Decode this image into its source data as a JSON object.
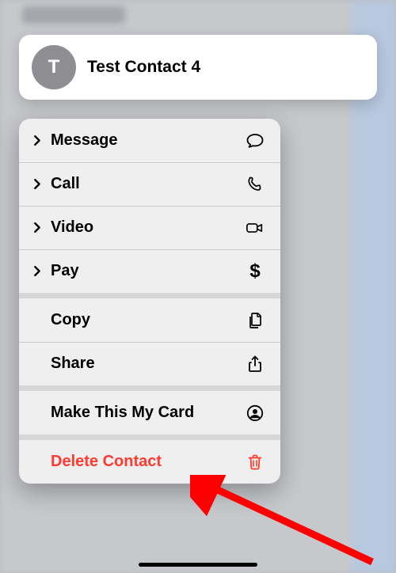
{
  "contact": {
    "initial": "T",
    "name": "Test Contact 4"
  },
  "menu": {
    "message": "Message",
    "call": "Call",
    "video": "Video",
    "pay": "Pay",
    "copy": "Copy",
    "share": "Share",
    "make_card": "Make This My Card",
    "delete": "Delete Contact"
  },
  "colors": {
    "destructive": "#ff3b30",
    "avatar_bg": "#8e8e93"
  }
}
